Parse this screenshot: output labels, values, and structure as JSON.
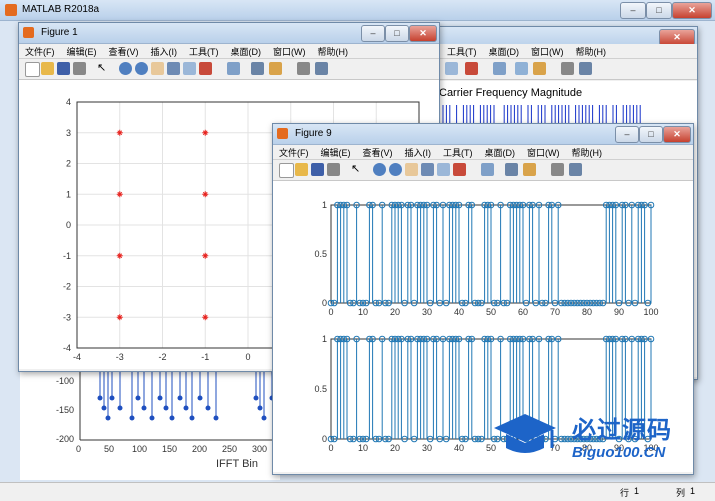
{
  "app": {
    "title": "MATLAB R2018a",
    "status_row_label": "行",
    "status_row_value": "1",
    "status_col_label": "列",
    "status_col_value": "1"
  },
  "menu": [
    "文件(F)",
    "编辑(E)",
    "查看(V)",
    "插入(I)",
    "工具(T)",
    "桌面(D)",
    "窗口(W)",
    "帮助(H)"
  ],
  "back_figure": {
    "title": "Carrier Frequency Magnitude",
    "menu_visible": [
      "工具(T)",
      "桌面(D)",
      "窗口(W)",
      "帮助(H)"
    ]
  },
  "bottom_axes": {
    "xlabel": "IFFT Bin",
    "yticks": [
      "-100",
      "-150",
      "-200"
    ],
    "xticks": [
      "0",
      "50",
      "100",
      "150",
      "200",
      "250",
      "300"
    ]
  },
  "figure1": {
    "title": "Figure 1"
  },
  "figure9": {
    "title": "Figure 9"
  },
  "watermark": {
    "text1": "必过源码",
    "text2": "Biguo100.CN"
  },
  "chart_data": [
    {
      "type": "scatter",
      "title": "",
      "xlabel": "",
      "ylabel": "",
      "xlim": [
        -4,
        4
      ],
      "ylim": [
        -4,
        4
      ],
      "xticks": [
        "-4",
        "-3",
        "-2",
        "-1",
        "0"
      ],
      "yticks": [
        "4",
        "3",
        "2",
        "1",
        "0",
        "-1",
        "-2",
        "-3",
        "-4"
      ],
      "grid": true,
      "series": [
        {
          "x": [
            -3,
            -3,
            -3,
            -3,
            -1,
            -1,
            -1,
            -1
          ],
          "y": [
            3,
            1,
            -1,
            -3,
            3,
            1,
            -1,
            -3
          ]
        }
      ],
      "color": "#e8211c"
    },
    {
      "type": "stem",
      "title": "",
      "xlim": [
        0,
        100
      ],
      "ylim": [
        0,
        1
      ],
      "xticks": [
        "0",
        "10",
        "20",
        "30",
        "40",
        "50",
        "60",
        "70",
        "80",
        "90",
        "100"
      ],
      "yticks": [
        "1",
        "0.5",
        "0"
      ],
      "color": "#1f77b4",
      "values": [
        0,
        0,
        1,
        1,
        1,
        1,
        0,
        0,
        1,
        0,
        0,
        0,
        1,
        1,
        0,
        0,
        1,
        0,
        0,
        1,
        1,
        1,
        1,
        0,
        1,
        1,
        0,
        1,
        1,
        1,
        1,
        0,
        1,
        1,
        0,
        1,
        0,
        1,
        1,
        1,
        1,
        0,
        0,
        1,
        1,
        0,
        0,
        0,
        1,
        1,
        1,
        0,
        0,
        1,
        0,
        0,
        1,
        1,
        1,
        1,
        1,
        0,
        1,
        1,
        0,
        1,
        0,
        0,
        1,
        1,
        0,
        1,
        0,
        0,
        0,
        0,
        0,
        0,
        0,
        0,
        0,
        0,
        0,
        0,
        0,
        0,
        1,
        1,
        1,
        1,
        0,
        1,
        1,
        0,
        1,
        0,
        1,
        1,
        1,
        0,
        1
      ]
    },
    {
      "type": "stem",
      "title": "",
      "xlim": [
        0,
        100
      ],
      "ylim": [
        0,
        1
      ],
      "xticks": [
        "0",
        "10",
        "20",
        "30",
        "40",
        "50",
        "60",
        "70",
        "80",
        "90",
        "100"
      ],
      "yticks": [
        "1",
        "0.5",
        "0"
      ],
      "color": "#1f77b4",
      "values": [
        0,
        0,
        1,
        1,
        1,
        1,
        0,
        0,
        1,
        0,
        0,
        0,
        1,
        1,
        0,
        0,
        1,
        0,
        0,
        1,
        1,
        1,
        1,
        0,
        1,
        1,
        0,
        1,
        1,
        1,
        1,
        0,
        1,
        1,
        0,
        1,
        0,
        1,
        1,
        1,
        1,
        0,
        0,
        1,
        1,
        0,
        0,
        0,
        1,
        1,
        1,
        0,
        0,
        1,
        0,
        0,
        1,
        1,
        1,
        1,
        1,
        0,
        1,
        1,
        0,
        1,
        0,
        0,
        1,
        1,
        0,
        1,
        0,
        0,
        0,
        0,
        0,
        0,
        0,
        0,
        0,
        0,
        0,
        0,
        0,
        0,
        1,
        1,
        1,
        1,
        0,
        1,
        1,
        0,
        1,
        0,
        1,
        1,
        1,
        0,
        1
      ]
    }
  ]
}
